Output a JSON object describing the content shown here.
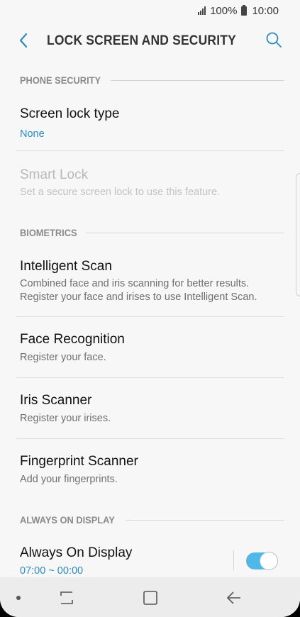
{
  "status_bar": {
    "battery": "100%",
    "time": "10:00"
  },
  "header": {
    "title": "LOCK SCREEN AND SECURITY"
  },
  "sections": {
    "phone_security": "PHONE SECURITY",
    "biometrics": "BIOMETRICS",
    "always_on_display": "ALWAYS ON DISPLAY"
  },
  "items": {
    "screen_lock_type": {
      "title": "Screen lock type",
      "subtitle": "None"
    },
    "smart_lock": {
      "title": "Smart Lock",
      "subtitle": "Set a secure screen lock to use this feature."
    },
    "intelligent_scan": {
      "title": "Intelligent Scan",
      "subtitle_line1": "Combined face and iris scanning for better results.",
      "subtitle_line2": "Register your face and irises to use Intelligent Scan."
    },
    "face_recognition": {
      "title": "Face Recognition",
      "subtitle": "Register your face."
    },
    "iris_scanner": {
      "title": "Iris Scanner",
      "subtitle": "Register your irises."
    },
    "fingerprint_scanner": {
      "title": "Fingerprint Scanner",
      "subtitle": "Add your fingerprints."
    },
    "always_on_display": {
      "title": "Always On Display",
      "subtitle": "07:00 ~ 00:00",
      "enabled": true
    }
  },
  "colors": {
    "accent": "#2e8bc0",
    "toggle_on": "#4fb8e6",
    "background": "#f7f7f7"
  },
  "icons": [
    "signal-icon",
    "battery-icon",
    "back-arrow-icon",
    "search-icon",
    "recents-icon",
    "home-icon",
    "back-nav-icon"
  ]
}
